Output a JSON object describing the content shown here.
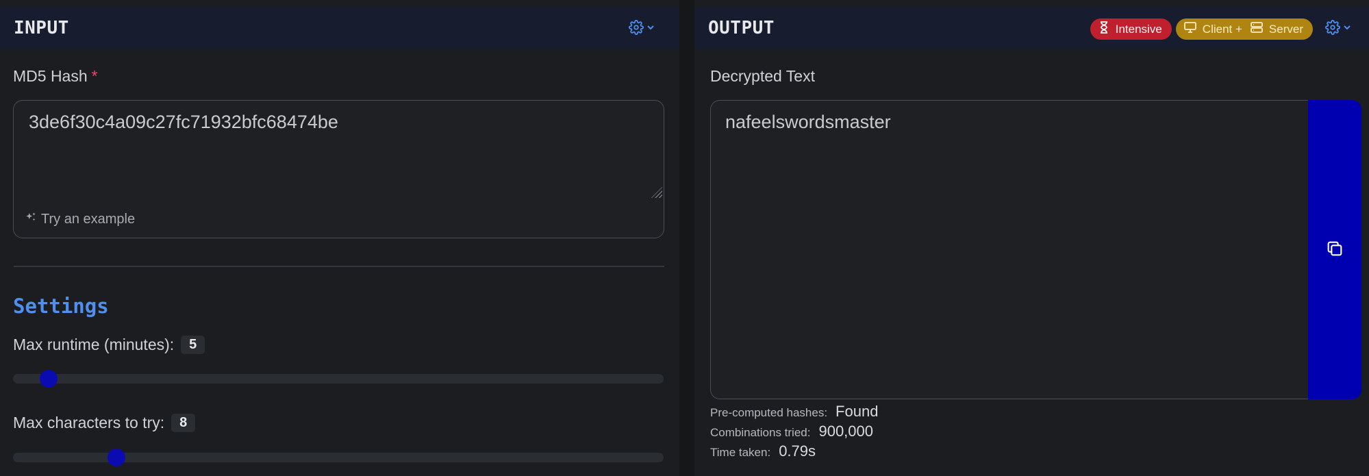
{
  "input_panel": {
    "title": "INPUT",
    "hash_label": "MD5 Hash",
    "required_mark": "*",
    "hash_value": "3de6f30c4a09c27fc71932bfc68474be",
    "example_link": "Try an example",
    "settings_title": "Settings",
    "max_runtime": {
      "label": "Max runtime (minutes):",
      "value": "5",
      "min": 1,
      "max": 120
    },
    "max_chars": {
      "label": "Max characters to try:",
      "value": "8",
      "min": 1,
      "max": 50
    }
  },
  "output_panel": {
    "title": "OUTPUT",
    "badges": {
      "intensive": "Intensive",
      "env": "Client +        Server",
      "env_client": "Client +",
      "env_server": "Server"
    },
    "result_label": "Decrypted Text",
    "result_value": "nafeelswordsmaster",
    "stats": [
      {
        "label": "Pre-computed hashes:",
        "value": "Found"
      },
      {
        "label": "Combinations tried:",
        "value": "900,000"
      },
      {
        "label": "Time taken:",
        "value": "0.79s"
      }
    ]
  },
  "icons": [
    "gear-icon",
    "chevron-down-icon",
    "hourglass-icon",
    "monitor-icon",
    "server-icon",
    "sparkle-icon",
    "copy-icon"
  ],
  "colors": {
    "accent": "#4f8fef",
    "slider_thumb": "#0b0bb2",
    "copy_button": "#0000b0",
    "intensive_badge": "#c01f2d",
    "env_badge": "#b08410",
    "required": "#e0506a"
  }
}
